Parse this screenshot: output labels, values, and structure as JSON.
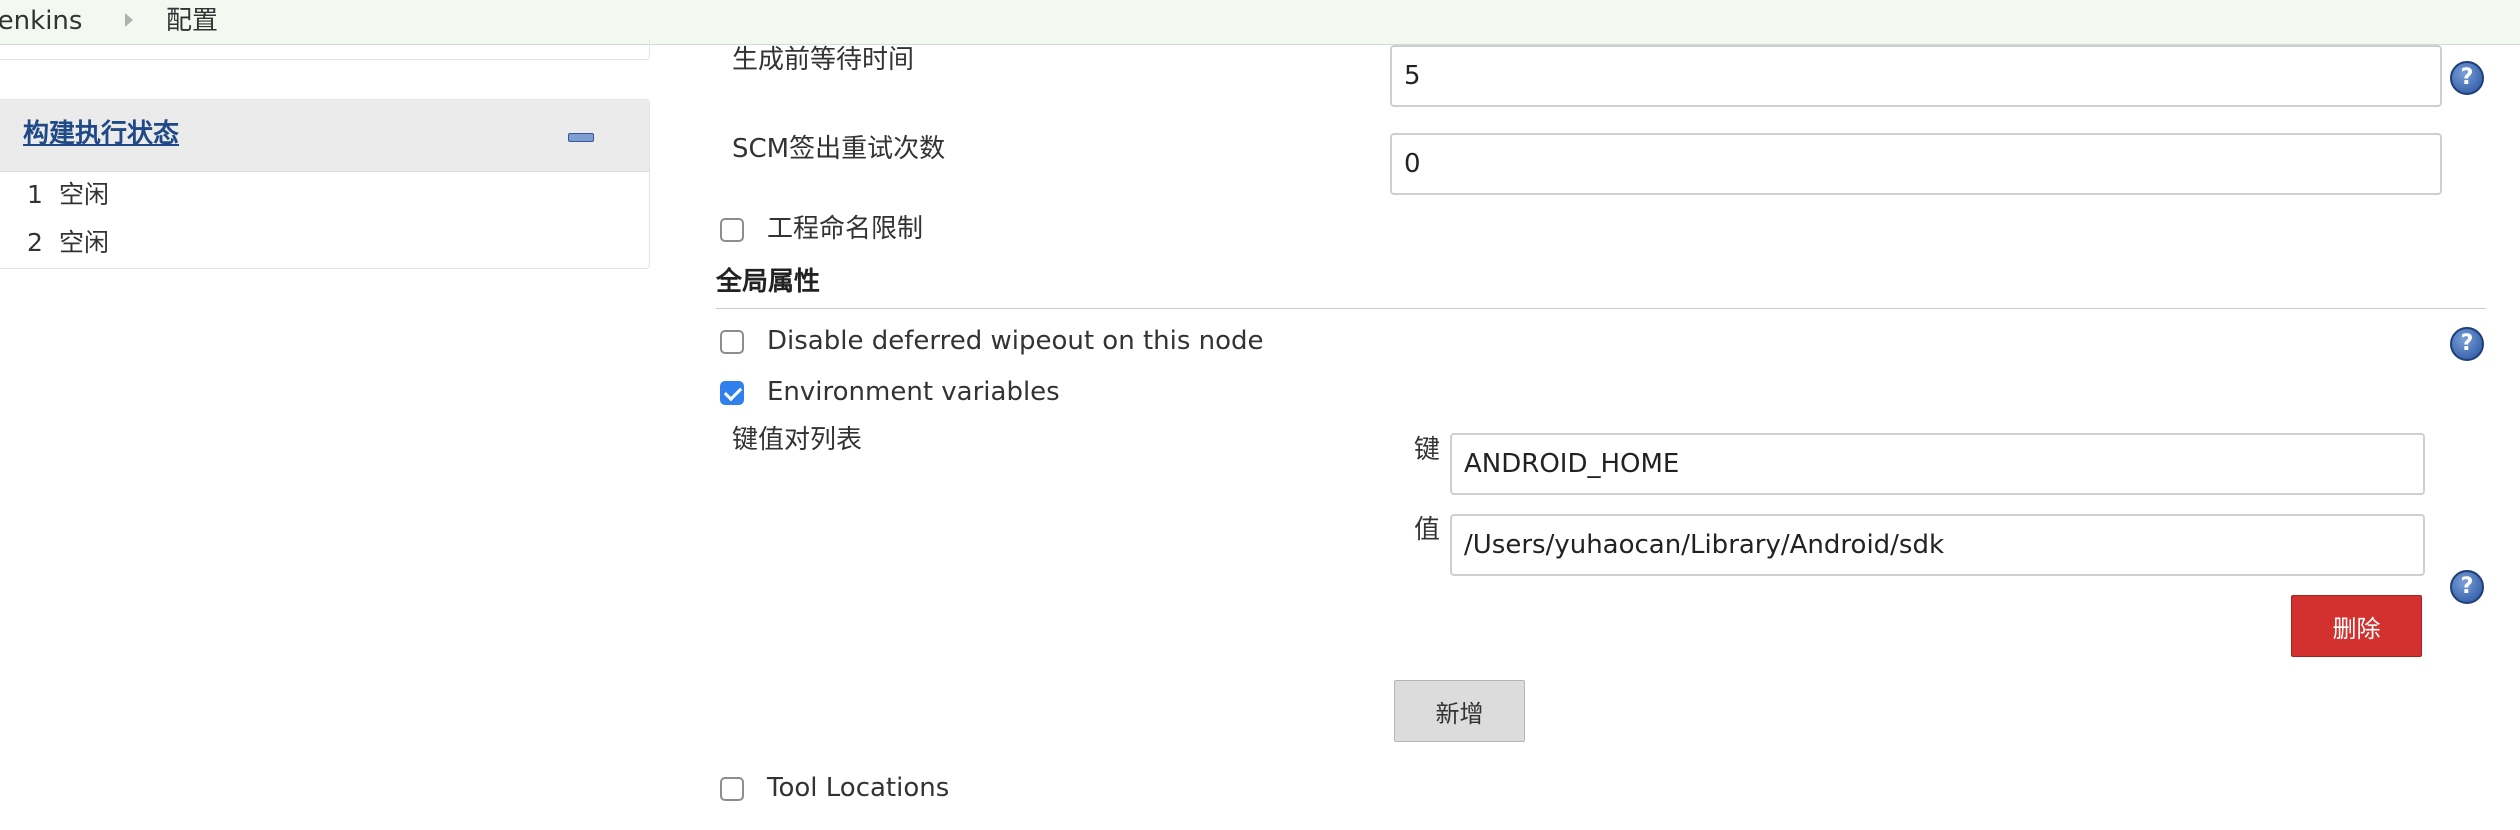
{
  "breadcrumb": {
    "items": [
      "Jenkins",
      "配置"
    ],
    "separator_icon": "chevron-right-icon"
  },
  "sidebar": {
    "executor_panel": {
      "title": "构建执行状态",
      "collapse_icon": "minus-icon",
      "executors": [
        {
          "number": "1",
          "status": "空闲"
        },
        {
          "number": "2",
          "status": "空闲"
        }
      ]
    }
  },
  "form": {
    "quiet_period": {
      "label": "生成前等待时间",
      "value": "5"
    },
    "scm_retry": {
      "label": "SCM签出重试次数",
      "value": "0"
    },
    "project_naming": {
      "label": "工程命名限制",
      "checked": false
    },
    "global_properties": {
      "header": "全局属性",
      "disable_wipeout": {
        "label": "Disable deferred wipeout on this node",
        "checked": false
      },
      "env_vars": {
        "label": "Environment variables",
        "checked": true,
        "list_label": "键值对列表",
        "key_label": "键",
        "key_value": "ANDROID_HOME",
        "value_label": "值",
        "value_value": "/Users/yuhaocan/Library/Android/sdk",
        "delete_label": "删除",
        "add_label": "新增"
      },
      "tool_locations": {
        "label": "Tool Locations",
        "checked": false
      }
    },
    "help_icon_glyph": "?",
    "help_icon": "help-icon"
  },
  "colors": {
    "breadcrumb_bg": "#f3f8f1",
    "link": "#204a87",
    "delete_button": "#d2312f",
    "checkbox_checked": "#2f80ed",
    "help_icon": "#3e68b0"
  }
}
